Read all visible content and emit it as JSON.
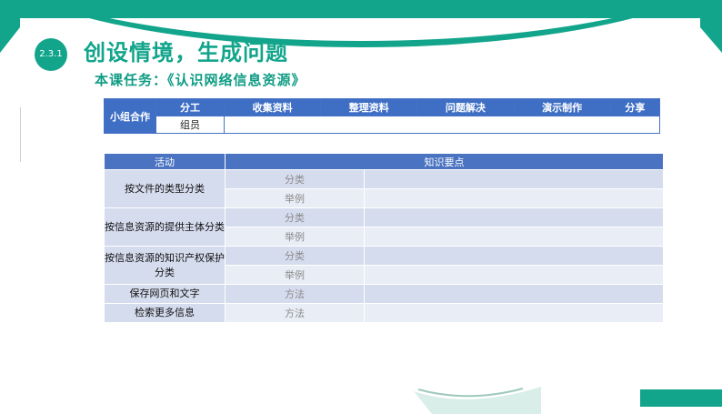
{
  "header": {
    "section_number": "2.3.1",
    "title": "创设情境，生成问题",
    "subtitle": "本课任务：《认识网络信息资源》"
  },
  "group_table": {
    "row_label": "小组合作",
    "columns": [
      "分工",
      "收集资料",
      "整理资料",
      "问题解决",
      "演示制作",
      "分享"
    ],
    "member_label": "组员"
  },
  "activity_table": {
    "headers": [
      "活动",
      "知识要点"
    ],
    "rows": [
      {
        "activity": "按文件的类型分类",
        "items": [
          "分类",
          "举例"
        ]
      },
      {
        "activity": "按信息资源的提供主体分类",
        "items": [
          "分类",
          "举例"
        ]
      },
      {
        "activity": "按信息资源的知识产权保护分类",
        "items": [
          "分类",
          "举例"
        ]
      },
      {
        "activity": "保存网页和文字",
        "items": [
          "方法"
        ]
      },
      {
        "activity": "检索更多信息",
        "items": [
          "方法"
        ]
      }
    ]
  },
  "colors": {
    "accent": "#12a58c",
    "table_header": "#3f6fc5",
    "cell": "#d5dcee"
  }
}
